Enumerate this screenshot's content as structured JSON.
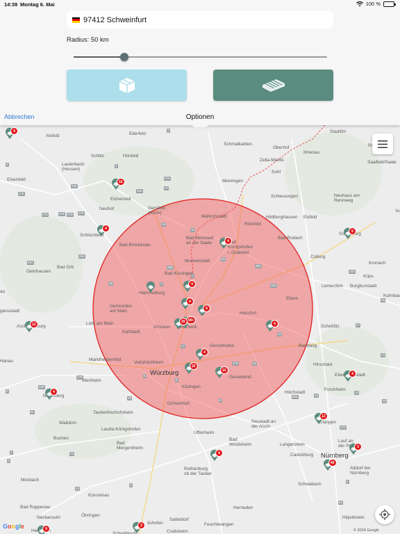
{
  "status_bar": {
    "time": "14:39",
    "date": "Montag 6. Mai",
    "battery": "100 %"
  },
  "search": {
    "flag_icon": "germany-flag-icon",
    "location": "97412 Schweinfurt"
  },
  "radius": {
    "label": "Radius: 50 km",
    "value_km": 50,
    "slider_fraction": 0.2
  },
  "buttons": {
    "box_icon": "package-box-icon",
    "pallet_icon": "pallet-icon"
  },
  "nav": {
    "cancel": "Abbrechen",
    "title": "Optionen"
  },
  "map": {
    "copyright": "© 2024 Google",
    "google_logo": [
      "G",
      "o",
      "o",
      "g",
      "l",
      "e"
    ],
    "places": [
      {
        "name": "Alsfeld",
        "cls": ""
      },
      {
        "name": "Eiterfeld",
        "cls": ""
      },
      {
        "name": "Schmalkalden",
        "cls": ""
      },
      {
        "name": "Stadtilm",
        "cls": ""
      },
      {
        "name": "Oberhof",
        "cls": ""
      },
      {
        "name": "Ilmenau",
        "cls": ""
      },
      {
        "name": "Zella-Mehlis",
        "cls": ""
      },
      {
        "name": "Suhl",
        "cls": ""
      },
      {
        "name": "Saalfeld/Saale",
        "cls": ""
      },
      {
        "name": "Schlitz",
        "cls": ""
      },
      {
        "name": "Hünfeld",
        "cls": ""
      },
      {
        "name": "Lauterbach\n(Hessen)",
        "cls": ""
      },
      {
        "name": "Meiningen",
        "cls": ""
      },
      {
        "name": "Schleusingen",
        "cls": ""
      },
      {
        "name": "Neuhaus am\nRennweg",
        "cls": ""
      },
      {
        "name": "Eichenzell",
        "cls": ""
      },
      {
        "name": "Gersfeld\n(Rhön)",
        "cls": ""
      },
      {
        "name": "Mellrichstadt",
        "cls": ""
      },
      {
        "name": "Hildburghausen",
        "cls": ""
      },
      {
        "name": "Eisfeld",
        "cls": ""
      },
      {
        "name": "Neuhof",
        "cls": ""
      },
      {
        "name": "Römhild",
        "cls": ""
      },
      {
        "name": "Sonneberg",
        "cls": ""
      },
      {
        "name": "Schlüchtern",
        "cls": ""
      },
      {
        "name": "Bad Neustadt\nan der Saale",
        "cls": ""
      },
      {
        "name": "Bad\nKönigshofen\ni. Grabfeld",
        "cls": ""
      },
      {
        "name": "Bad Rodach",
        "cls": ""
      },
      {
        "name": "Bad Brückenau",
        "cls": ""
      },
      {
        "name": "Coburg",
        "cls": ""
      },
      {
        "name": "Kronach",
        "cls": ""
      },
      {
        "name": "Munnerstadt",
        "cls": ""
      },
      {
        "name": "Bad Orb",
        "cls": ""
      },
      {
        "name": "Gelnhausen",
        "cls": ""
      },
      {
        "name": "Bad Kissingen",
        "cls": ""
      },
      {
        "name": "Lichtenfels",
        "cls": ""
      },
      {
        "name": "Burgkunstadt",
        "cls": ""
      },
      {
        "name": "Küps",
        "cls": ""
      },
      {
        "name": "Hammelburg",
        "cls": ""
      },
      {
        "name": "Ebern",
        "cls": ""
      },
      {
        "name": "Kulmbach",
        "cls": ""
      },
      {
        "name": "Gemunden\nam Main",
        "cls": ""
      },
      {
        "name": "Hassfurt",
        "cls": ""
      },
      {
        "name": "Lohr am Main",
        "cls": ""
      },
      {
        "name": "Arnstein",
        "cls": ""
      },
      {
        "name": "Werneck",
        "cls": ""
      },
      {
        "name": "Aschaffenburg",
        "cls": ""
      },
      {
        "name": "Karlstadt",
        "cls": ""
      },
      {
        "name": "Scheßlitz",
        "cls": ""
      },
      {
        "name": "Gerolzhofen",
        "cls": ""
      },
      {
        "name": "Bamberg",
        "cls": ""
      },
      {
        "name": "Marktheidenfeld",
        "cls": ""
      },
      {
        "name": "Veitshöchheim",
        "cls": ""
      },
      {
        "name": "Hirschaid",
        "cls": ""
      },
      {
        "name": "Würzburg",
        "cls": "big"
      },
      {
        "name": "Geiselwind",
        "cls": ""
      },
      {
        "name": "Ebermannstadt",
        "cls": ""
      },
      {
        "name": "Wertheim",
        "cls": ""
      },
      {
        "name": "Kitzingen",
        "cls": ""
      },
      {
        "name": "Höchstadt",
        "cls": ""
      },
      {
        "name": "Forchheim",
        "cls": ""
      },
      {
        "name": "Miltenberg",
        "cls": ""
      },
      {
        "name": "Ochsenfurt",
        "cls": ""
      },
      {
        "name": "Tauberbischofsheim",
        "cls": ""
      },
      {
        "name": "Neustadt an\nder Aisch",
        "cls": ""
      },
      {
        "name": "Erlangen",
        "cls": ""
      },
      {
        "name": "Walldürn",
        "cls": ""
      },
      {
        "name": "Lauda-Königshofen",
        "cls": ""
      },
      {
        "name": "Uffenheim",
        "cls": ""
      },
      {
        "name": "Lauf an\nder Pegnitz",
        "cls": ""
      },
      {
        "name": "Buchen",
        "cls": ""
      },
      {
        "name": "Bad\nMergentheim",
        "cls": ""
      },
      {
        "name": "Bad\nWindsheim",
        "cls": ""
      },
      {
        "name": "Langenzenn",
        "cls": ""
      },
      {
        "name": "Nürnberg",
        "cls": "big"
      },
      {
        "name": "Cadolzburg",
        "cls": ""
      },
      {
        "name": "Mosbach",
        "cls": ""
      },
      {
        "name": "Rothenburg\nob der Tauber",
        "cls": ""
      },
      {
        "name": "Altdorf bei\nNürnberg",
        "cls": ""
      },
      {
        "name": "Schwabach",
        "cls": ""
      },
      {
        "name": "Künzelsau",
        "cls": ""
      },
      {
        "name": "Bad Rappenau",
        "cls": ""
      },
      {
        "name": "Herrieden",
        "cls": ""
      },
      {
        "name": "Neckarsulm",
        "cls": ""
      },
      {
        "name": "Öhringen",
        "cls": ""
      },
      {
        "name": "Ilshofen",
        "cls": ""
      },
      {
        "name": "Satteldorf",
        "cls": ""
      },
      {
        "name": "Feuchtwangen",
        "cls": ""
      },
      {
        "name": "Hilpoltstein",
        "cls": ""
      },
      {
        "name": "Crailsheim",
        "cls": ""
      },
      {
        "name": "Heilbronn",
        "cls": ""
      },
      {
        "name": "Schwäbisch",
        "cls": ""
      },
      {
        "name": "Ruhl",
        "cls": ""
      },
      {
        "name": "Elsenfeld",
        "cls": ""
      },
      {
        "name": "burg",
        "cls": ""
      },
      {
        "name": "au",
        "cls": ""
      },
      {
        "name": "gensstadt",
        "cls": ""
      },
      {
        "name": "Hanau",
        "cls": ""
      }
    ],
    "markers": [
      "16",
      "4",
      "4",
      "6",
      "4",
      "4",
      "6",
      "99+",
      "20",
      "4",
      "12",
      "4",
      "10",
      "20",
      "4",
      "12",
      "4",
      "3",
      "4",
      "9",
      "40",
      "3",
      "",
      "4"
    ],
    "road_numbers": [
      "276",
      "456",
      "279",
      "279",
      "27",
      "279",
      "456",
      "285",
      "303",
      "279",
      "303",
      "457",
      "279",
      "303",
      "26",
      "22",
      "470",
      "505",
      "22",
      "19",
      "27",
      "468",
      "8",
      "81",
      "8",
      "8",
      "470",
      "25",
      "13",
      "8",
      "9",
      "19",
      "45",
      "43",
      "9",
      "7",
      "7",
      "13",
      "33",
      "248",
      "3",
      "4",
      "3",
      "26",
      "275",
      "1",
      "10",
      "2",
      "85",
      "79",
      "17"
    ]
  }
}
